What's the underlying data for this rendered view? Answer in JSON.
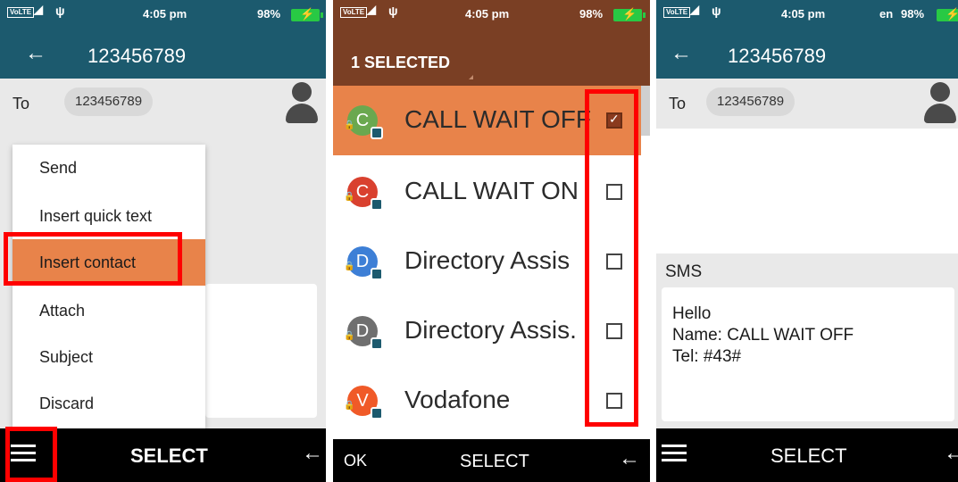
{
  "status": {
    "volte": "VoLTE",
    "network": "4G",
    "time": "4:05 pm",
    "battery": "98%",
    "lang": "en"
  },
  "compose": {
    "title": "123456789",
    "to_label": "To",
    "recipient_chip": "123456789"
  },
  "options_menu": {
    "items": [
      {
        "label": "Send"
      },
      {
        "label": "Insert quick text"
      },
      {
        "label": "Insert contact",
        "highlighted": true
      },
      {
        "label": "Attach"
      },
      {
        "label": "Subject"
      },
      {
        "label": "Discard"
      }
    ]
  },
  "softkeys_panel1": {
    "center": "SELECT"
  },
  "contact_picker": {
    "header": "1 SELECTED",
    "contacts": [
      {
        "initial": "C",
        "name": "CALL WAIT OFF",
        "color": "#6aa84f",
        "checked": true
      },
      {
        "initial": "C",
        "name": "CALL WAIT ON",
        "color": "#d9412f",
        "checked": false
      },
      {
        "initial": "D",
        "name": "Directory Assis",
        "color": "#3d7fd6",
        "checked": false
      },
      {
        "initial": "D",
        "name": "Directory Assis.",
        "color": "#6f6f6f",
        "checked": false
      },
      {
        "initial": "V",
        "name": "Vodafone",
        "color": "#f05a28",
        "checked": false
      }
    ],
    "softkeys": {
      "left": "OK",
      "center": "SELECT"
    }
  },
  "result": {
    "sms_label": "SMS",
    "sms_lines": [
      "Hello",
      "Name: CALL WAIT OFF",
      "Tel: #43#"
    ],
    "softkeys": {
      "center": "SELECT"
    }
  },
  "colors": {
    "teal_header": "#1c5a6e",
    "brown_header": "#7a3f24",
    "highlight": "#e8834a",
    "annotation_red": "#ff0000"
  }
}
